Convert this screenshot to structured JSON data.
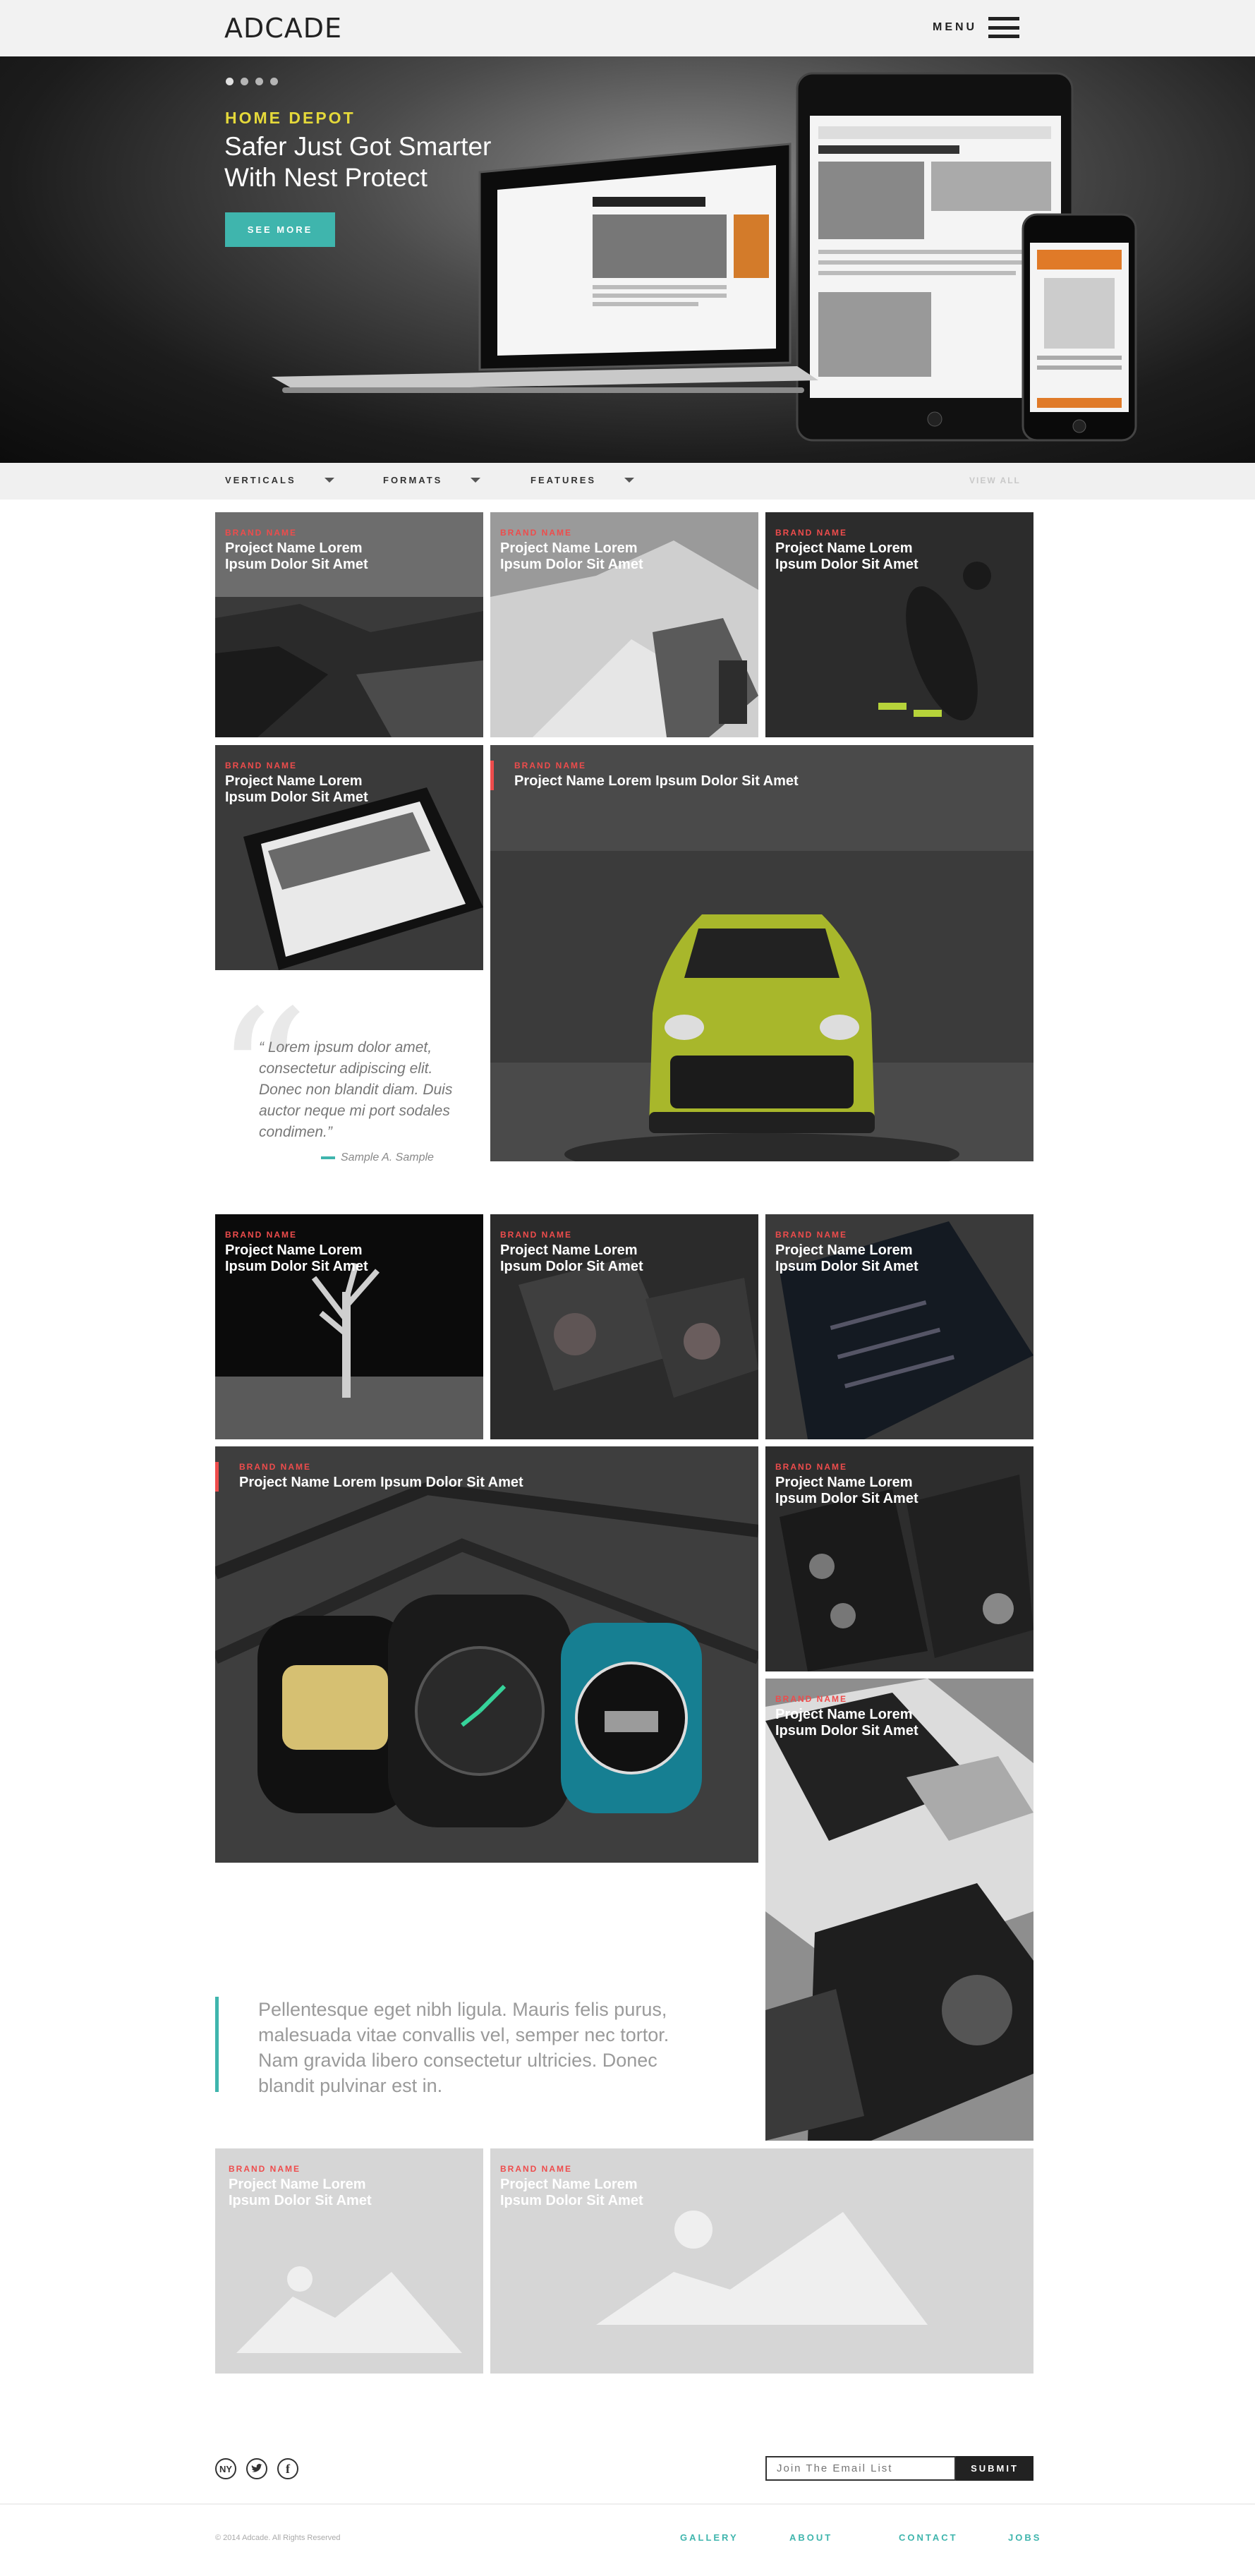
{
  "header": {
    "logo": "ADCADE",
    "menu_label": "MENU"
  },
  "hero": {
    "brand": "HOME DEPOT",
    "title": "Safer Just Got Smarter With Nest Protect",
    "button": "SEE MORE",
    "slides": 4
  },
  "filters": {
    "items": [
      "VERTICALS",
      "FORMATS",
      "FEATURES"
    ],
    "view_all": "VIEW ALL"
  },
  "tiles": [
    {
      "brand": "BRAND NAME",
      "title": "Project Name Lorem Ipsum Dolor Sit Amet"
    },
    {
      "brand": "BRAND NAME",
      "title": "Project Name Lorem Ipsum Dolor Sit Amet"
    },
    {
      "brand": "BRAND NAME",
      "title": "Project Name Lorem Ipsum Dolor Sit Amet"
    },
    {
      "brand": "BRAND NAME",
      "title": "Project Name Lorem Ipsum Dolor Sit Amet"
    },
    {
      "brand": "BRAND NAME",
      "title": "Project Name Lorem Ipsum Dolor Sit Amet"
    },
    {
      "brand": "BRAND NAME",
      "title": "Project Name Lorem Ipsum Dolor Sit Amet"
    },
    {
      "brand": "BRAND NAME",
      "title": "Project Name Lorem Ipsum Dolor Sit Amet"
    },
    {
      "brand": "BRAND NAME",
      "title": "Project Name Lorem Ipsum Dolor Sit Amet"
    },
    {
      "brand": "BRAND NAME",
      "title": "Project Name Lorem Ipsum Dolor Sit Amet"
    },
    {
      "brand": "BRAND NAME",
      "title": "Project Name Lorem Ipsum Dolor Sit Amet"
    },
    {
      "brand": "BRAND NAME",
      "title": "Project Name Lorem Ipsum Dolor Sit Amet"
    },
    {
      "brand": "BRAND NAME",
      "title": "Project Name Lorem Ipsum Dolor Sit Amet"
    },
    {
      "brand": "BRAND NAME",
      "title": "Project Name Lorem Ipsum Dolor Sit Amet"
    }
  ],
  "quote": {
    "text": "“ Lorem ipsum dolor amet, consectetur adipiscing elit. Donec non blandit diam. Duis auctor neque mi port sodales condimen.”",
    "author": "Sample A. Sample"
  },
  "excerpt": "Pellentesque eget nibh ligula. Mauris felis purus, malesuada vitae convallis vel, semper nec tortor. Nam gravida libero consectetur ultricies. Donec blandit pulvinar est in.",
  "footer": {
    "social": [
      "NY",
      "twitter",
      "facebook"
    ],
    "email_placeholder": "Join The Email List",
    "submit": "SUBMIT",
    "copyright": "© 2014 Adcade. All Rights Reserved",
    "links": [
      "GALLERY",
      "ABOUT",
      "CONTACT",
      "JOBS"
    ]
  },
  "colors": {
    "accent": "#3fb5ad",
    "brand_red": "#ee4c4c",
    "hero_brand": "#e5d93a"
  }
}
